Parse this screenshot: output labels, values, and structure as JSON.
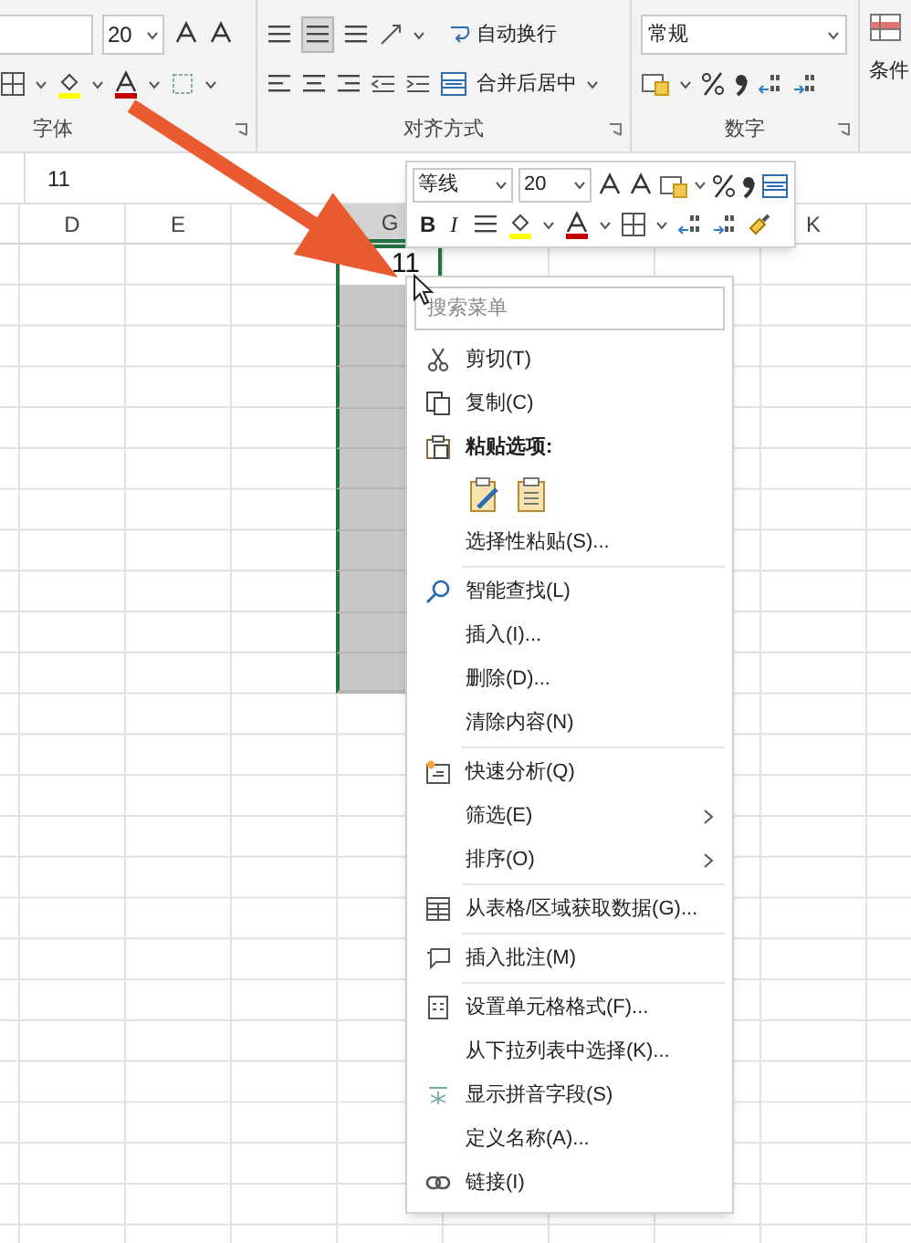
{
  "ribbon": {
    "font_size": "20",
    "wrap_text": "自动换行",
    "merge_center": "合并后居中",
    "number_format": "常规",
    "next_group": "条件",
    "groups": [
      {
        "label": "字体"
      },
      {
        "label": "对齐方式"
      },
      {
        "label": "数字"
      }
    ]
  },
  "formula_bar": {
    "value": "11"
  },
  "grid": {
    "columns": [
      {
        "label": "D",
        "selected": false
      },
      {
        "label": "E",
        "selected": false
      },
      {
        "label": "G",
        "selected": true
      },
      {
        "label": "K",
        "selected": false
      }
    ],
    "rows": [
      {
        "selected": true,
        "value": "11"
      },
      {
        "selected": true
      },
      {
        "selected": true
      },
      {
        "selected": true
      },
      {
        "selected": true
      },
      {
        "selected": true
      },
      {
        "selected": true
      },
      {
        "selected": true
      },
      {
        "selected": true
      },
      {
        "selected": true
      },
      {
        "selected": true
      }
    ]
  },
  "mini_toolbar": {
    "font": "等线",
    "font_size": "20",
    "bold": "B",
    "italic": "I"
  },
  "context_menu": {
    "search": {
      "placeholder": "搜索菜单"
    },
    "items": [
      {
        "kind": "item",
        "label": "剪切(T)"
      },
      {
        "kind": "item",
        "label": "复制(C)"
      },
      {
        "kind": "header",
        "label": "粘贴选项:"
      },
      {
        "kind": "paste_options"
      },
      {
        "kind": "item",
        "label": "选择性粘贴(S)..."
      },
      {
        "kind": "separator"
      },
      {
        "kind": "item",
        "label": "智能查找(L)"
      },
      {
        "kind": "item",
        "label": "插入(I)..."
      },
      {
        "kind": "item",
        "label": "删除(D)..."
      },
      {
        "kind": "item",
        "label": "清除内容(N)"
      },
      {
        "kind": "separator"
      },
      {
        "kind": "item",
        "label": "快速分析(Q)"
      },
      {
        "kind": "item",
        "label": "筛选(E)",
        "submenu": true
      },
      {
        "kind": "item",
        "label": "排序(O)",
        "submenu": true
      },
      {
        "kind": "separator"
      },
      {
        "kind": "item",
        "label": "从表格/区域获取数据(G)..."
      },
      {
        "kind": "separator"
      },
      {
        "kind": "item",
        "label": "插入批注(M)"
      },
      {
        "kind": "separator"
      },
      {
        "kind": "item",
        "label": "设置单元格格式(F)..."
      },
      {
        "kind": "item",
        "label": "从下拉列表中选择(K)..."
      },
      {
        "kind": "item",
        "label": "显示拼音字段(S)"
      },
      {
        "kind": "item",
        "label": "定义名称(A)..."
      },
      {
        "kind": "item",
        "label": "链接(I)"
      }
    ]
  }
}
